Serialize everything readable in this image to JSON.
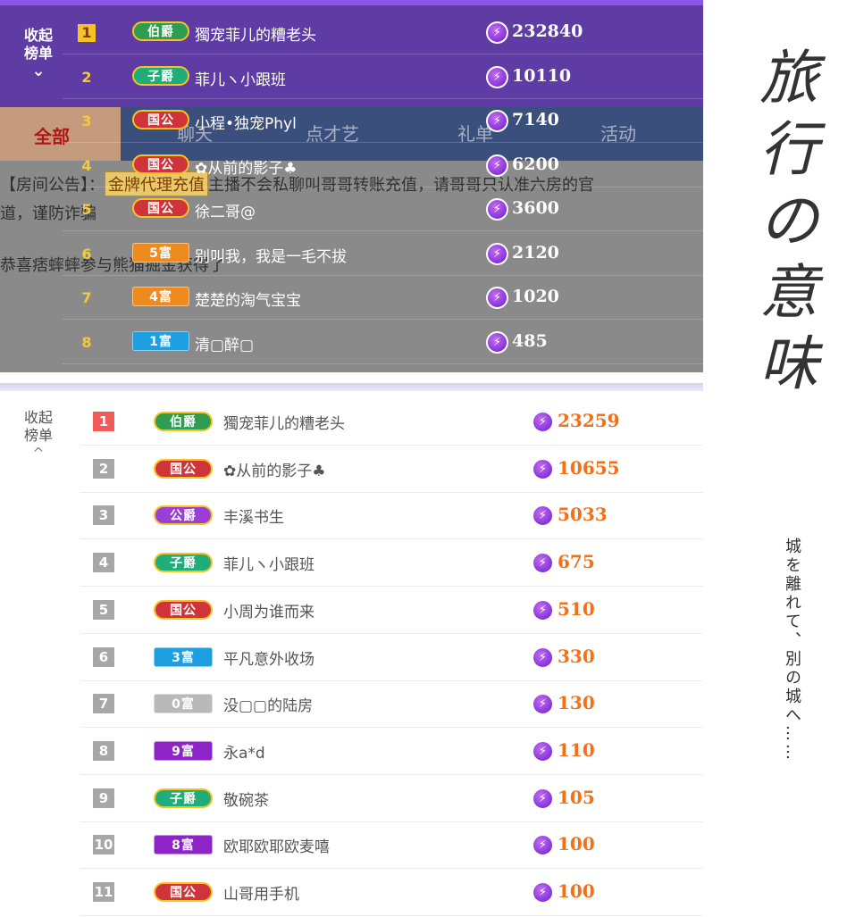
{
  "top_panel": {
    "collapse_label": "收起榜单",
    "collapse_arrow": "⌄",
    "rows": [
      {
        "rank": "1",
        "badge": "伯爵",
        "badge_color": "#2e9d52",
        "name": "獨宠菲儿的糟老头",
        "score": "232840"
      },
      {
        "rank": "2",
        "badge": "子爵",
        "badge_color": "#1fae7a",
        "name": "菲儿ヽ小跟班",
        "score": "10110"
      },
      {
        "rank": "3",
        "badge": "国公",
        "badge_color": "#d0343a",
        "name": "小程•独宠Phyl",
        "score": "7140"
      },
      {
        "rank": "4",
        "badge": "国公",
        "badge_color": "#d0343a",
        "name": "✿从前的影子♣",
        "score": "6200"
      },
      {
        "rank": "5",
        "badge": "国公",
        "badge_color": "#d0343a",
        "name": "徐二哥@",
        "score": "3600"
      },
      {
        "rank": "6",
        "badge": "5富",
        "badge_color": "#ef8b1c",
        "name": "别叫我，我是一毛不拔",
        "score": "2120"
      },
      {
        "rank": "7",
        "badge": "4富",
        "badge_color": "#ef8b1c",
        "name": "楚楚的淘气宝宝",
        "score": "1020"
      },
      {
        "rank": "8",
        "badge": "1富",
        "badge_color": "#1d9fe2",
        "name": "清▢醉▢",
        "score": "485"
      }
    ]
  },
  "tabs": [
    {
      "label": "全部"
    },
    {
      "label": "聊天"
    },
    {
      "label": "点才艺"
    },
    {
      "label": "礼单"
    },
    {
      "label": "活动"
    }
  ],
  "notice": {
    "prefix": "【房间公告】：",
    "highlight": "金牌代理充值",
    "text": "主播不会私聊叫哥哥转账充值，请哥哥只认准六房的官",
    "line2": "道，谨防诈骗",
    "line3": "恭喜痞蟀蟀参与熊猫掘金获得了"
  },
  "bottom_panel": {
    "collapse_label": "收起榜单",
    "collapse_arrow": "^",
    "rows": [
      {
        "rank": "1",
        "badge": "伯爵",
        "badge_color": "#2e9d52",
        "name": "獨宠菲儿的糟老头",
        "score": "23259"
      },
      {
        "rank": "2",
        "badge": "国公",
        "badge_color": "#d0343a",
        "name": "✿从前的影子♣",
        "score": "10655"
      },
      {
        "rank": "3",
        "badge": "公爵",
        "badge_color": "#9a3ed8",
        "name": "丰溪书生",
        "score": "5033"
      },
      {
        "rank": "4",
        "badge": "子爵",
        "badge_color": "#1fae7a",
        "name": "菲儿ヽ小跟班",
        "score": "675"
      },
      {
        "rank": "5",
        "badge": "国公",
        "badge_color": "#d0343a",
        "name": "小周为谁而来",
        "score": "510"
      },
      {
        "rank": "6",
        "badge": "3富",
        "badge_color": "#1d9fe2",
        "name": "平凡意外收场",
        "score": "330"
      },
      {
        "rank": "7",
        "badge": "0富",
        "badge_color": "#b9b9b9",
        "name": "没▢▢的陆房",
        "score": "130"
      },
      {
        "rank": "8",
        "badge": "9富",
        "badge_color": "#8e24c8",
        "name": "永a*d",
        "score": "110"
      },
      {
        "rank": "9",
        "badge": "子爵",
        "badge_color": "#1fae7a",
        "name": "敬碗茶",
        "score": "105"
      },
      {
        "rank": "10",
        "badge": "8富",
        "badge_color": "#8e24c8",
        "name": "欧耶欧耶欧麦嘻",
        "score": "100"
      },
      {
        "rank": "11",
        "badge": "国公",
        "badge_color": "#d0343a",
        "name": "山哥用手机",
        "score": "100"
      }
    ]
  },
  "side_title": {
    "chars": [
      "旅",
      "行",
      "の",
      "意",
      "味"
    ],
    "vertical_text": "城を離れて、別の城へ……"
  },
  "icons": {
    "gift": "lightning-bolt-icon"
  }
}
